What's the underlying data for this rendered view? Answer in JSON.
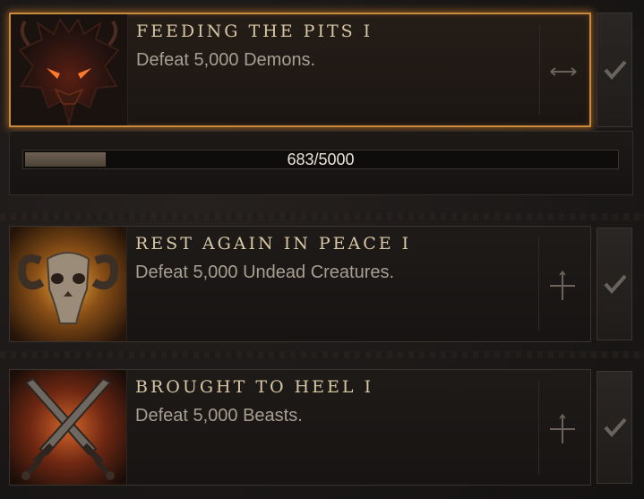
{
  "achievements": [
    {
      "title": "FEEDING THE PITS I",
      "description": "Defeat 5,000 Demons.",
      "icon": "demon-head-icon",
      "selected": true,
      "expand_icon": "collapse-arrows-icon",
      "progress": {
        "text": "683/5000",
        "current": 683,
        "total": 5000
      }
    },
    {
      "title": "REST AGAIN IN PEACE I",
      "description": "Defeat 5,000 Undead Creatures.",
      "icon": "ram-skull-icon",
      "selected": false,
      "expand_icon": "expand-cross-icon"
    },
    {
      "title": "BROUGHT TO HEEL I",
      "description": "Defeat 5,000 Beasts.",
      "icon": "crossed-swords-icon",
      "selected": false,
      "expand_icon": "expand-cross-icon"
    }
  ],
  "colors": {
    "accent": "#c98a3e",
    "title": "#d8c7a4",
    "description": "#a89f93"
  }
}
